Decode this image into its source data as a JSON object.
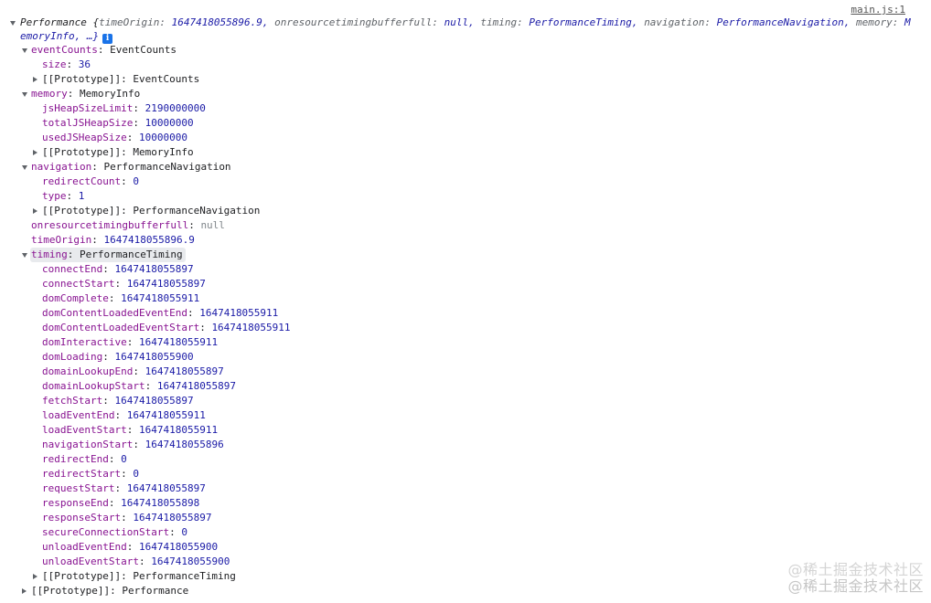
{
  "source_link": "main.js:1",
  "root": {
    "summary_prefix": "Performance {",
    "summary_fields": [
      {
        "k": "timeOrigin",
        "v": "1647418055896.9"
      },
      {
        "k": "onresourcetimingbufferfull",
        "v": "null"
      },
      {
        "k": "timing",
        "v": "PerformanceTiming"
      },
      {
        "k": "navigation",
        "v": "PerformanceNavigation"
      },
      {
        "k": "memory",
        "v": "M"
      }
    ],
    "summary_line2": "emoryInfo, …}",
    "info_icon_glyph": "i"
  },
  "tree": [
    {
      "indent": 1,
      "tri": "down",
      "key": "eventCounts",
      "val": "EventCounts",
      "vtype": "obj"
    },
    {
      "indent": 2,
      "tri": null,
      "key": "size",
      "val": "36",
      "vtype": "num"
    },
    {
      "indent": 2,
      "tri": "right",
      "key": "[[Prototype]]",
      "val": "EventCounts",
      "vtype": "obj",
      "faded": true
    },
    {
      "indent": 1,
      "tri": "down",
      "key": "memory",
      "val": "MemoryInfo",
      "vtype": "obj"
    },
    {
      "indent": 2,
      "tri": null,
      "key": "jsHeapSizeLimit",
      "val": "2190000000",
      "vtype": "num"
    },
    {
      "indent": 2,
      "tri": null,
      "key": "totalJSHeapSize",
      "val": "10000000",
      "vtype": "num"
    },
    {
      "indent": 2,
      "tri": null,
      "key": "usedJSHeapSize",
      "val": "10000000",
      "vtype": "num"
    },
    {
      "indent": 2,
      "tri": "right",
      "key": "[[Prototype]]",
      "val": "MemoryInfo",
      "vtype": "obj",
      "faded": true
    },
    {
      "indent": 1,
      "tri": "down",
      "key": "navigation",
      "val": "PerformanceNavigation",
      "vtype": "obj"
    },
    {
      "indent": 2,
      "tri": null,
      "key": "redirectCount",
      "val": "0",
      "vtype": "num"
    },
    {
      "indent": 2,
      "tri": null,
      "key": "type",
      "val": "1",
      "vtype": "num"
    },
    {
      "indent": 2,
      "tri": "right",
      "key": "[[Prototype]]",
      "val": "PerformanceNavigation",
      "vtype": "obj",
      "faded": true
    },
    {
      "indent": 1,
      "tri": null,
      "key": "onresourcetimingbufferfull",
      "val": "null",
      "vtype": "null"
    },
    {
      "indent": 1,
      "tri": null,
      "key": "timeOrigin",
      "val": "1647418055896.9",
      "vtype": "num"
    },
    {
      "indent": 1,
      "tri": "down",
      "key": "timing",
      "val": "PerformanceTiming",
      "vtype": "obj",
      "highlight": true
    },
    {
      "indent": 2,
      "tri": null,
      "key": "connectEnd",
      "val": "1647418055897",
      "vtype": "num"
    },
    {
      "indent": 2,
      "tri": null,
      "key": "connectStart",
      "val": "1647418055897",
      "vtype": "num"
    },
    {
      "indent": 2,
      "tri": null,
      "key": "domComplete",
      "val": "1647418055911",
      "vtype": "num"
    },
    {
      "indent": 2,
      "tri": null,
      "key": "domContentLoadedEventEnd",
      "val": "1647418055911",
      "vtype": "num"
    },
    {
      "indent": 2,
      "tri": null,
      "key": "domContentLoadedEventStart",
      "val": "1647418055911",
      "vtype": "num"
    },
    {
      "indent": 2,
      "tri": null,
      "key": "domInteractive",
      "val": "1647418055911",
      "vtype": "num"
    },
    {
      "indent": 2,
      "tri": null,
      "key": "domLoading",
      "val": "1647418055900",
      "vtype": "num"
    },
    {
      "indent": 2,
      "tri": null,
      "key": "domainLookupEnd",
      "val": "1647418055897",
      "vtype": "num"
    },
    {
      "indent": 2,
      "tri": null,
      "key": "domainLookupStart",
      "val": "1647418055897",
      "vtype": "num"
    },
    {
      "indent": 2,
      "tri": null,
      "key": "fetchStart",
      "val": "1647418055897",
      "vtype": "num"
    },
    {
      "indent": 2,
      "tri": null,
      "key": "loadEventEnd",
      "val": "1647418055911",
      "vtype": "num"
    },
    {
      "indent": 2,
      "tri": null,
      "key": "loadEventStart",
      "val": "1647418055911",
      "vtype": "num"
    },
    {
      "indent": 2,
      "tri": null,
      "key": "navigationStart",
      "val": "1647418055896",
      "vtype": "num"
    },
    {
      "indent": 2,
      "tri": null,
      "key": "redirectEnd",
      "val": "0",
      "vtype": "num"
    },
    {
      "indent": 2,
      "tri": null,
      "key": "redirectStart",
      "val": "0",
      "vtype": "num"
    },
    {
      "indent": 2,
      "tri": null,
      "key": "requestStart",
      "val": "1647418055897",
      "vtype": "num"
    },
    {
      "indent": 2,
      "tri": null,
      "key": "responseEnd",
      "val": "1647418055898",
      "vtype": "num"
    },
    {
      "indent": 2,
      "tri": null,
      "key": "responseStart",
      "val": "1647418055897",
      "vtype": "num"
    },
    {
      "indent": 2,
      "tri": null,
      "key": "secureConnectionStart",
      "val": "0",
      "vtype": "num"
    },
    {
      "indent": 2,
      "tri": null,
      "key": "unloadEventEnd",
      "val": "1647418055900",
      "vtype": "num"
    },
    {
      "indent": 2,
      "tri": null,
      "key": "unloadEventStart",
      "val": "1647418055900",
      "vtype": "num"
    },
    {
      "indent": 2,
      "tri": "right",
      "key": "[[Prototype]]",
      "val": "PerformanceTiming",
      "vtype": "obj",
      "faded": true
    },
    {
      "indent": 1,
      "tri": "right",
      "key": "[[Prototype]]",
      "val": "Performance",
      "vtype": "obj",
      "faded": true
    }
  ],
  "watermark": "@稀土掘金技术社区",
  "colors": {
    "key": "#881391",
    "number": "#1a1aa6",
    "null": "#80868b",
    "highlight": "#e8eaed"
  }
}
